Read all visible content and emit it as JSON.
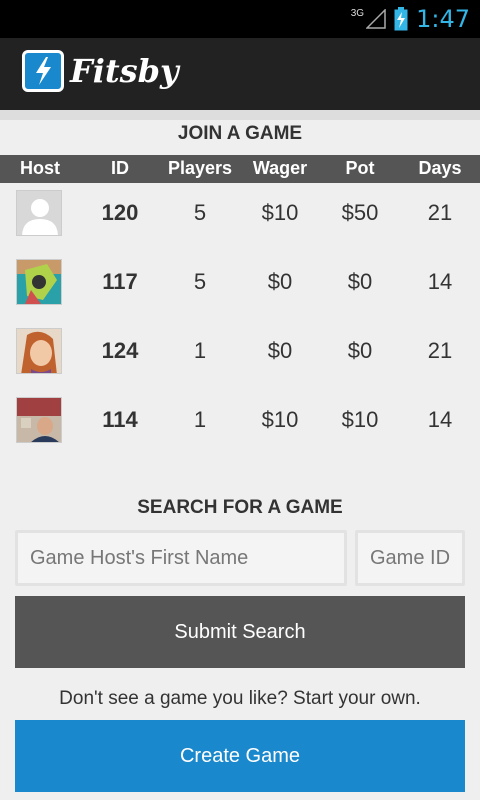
{
  "status_bar": {
    "network": "3G",
    "time": "1:47"
  },
  "app": {
    "title": "Fitsby"
  },
  "join": {
    "title": "JOIN A GAME",
    "columns": [
      "Host",
      "ID",
      "Players",
      "Wager",
      "Pot",
      "Days"
    ],
    "rows": [
      {
        "id": "120",
        "players": "5",
        "wager": "$10",
        "pot": "$50",
        "days": "21"
      },
      {
        "id": "117",
        "players": "5",
        "wager": "$0",
        "pot": "$0",
        "days": "14"
      },
      {
        "id": "124",
        "players": "1",
        "wager": "$0",
        "pot": "$0",
        "days": "21"
      },
      {
        "id": "114",
        "players": "1",
        "wager": "$10",
        "pot": "$10",
        "days": "14"
      }
    ]
  },
  "search": {
    "title": "SEARCH FOR A GAME",
    "host_placeholder": "Game Host's First Name",
    "id_placeholder": "Game ID",
    "submit_label": "Submit Search"
  },
  "create": {
    "prompt": "Don't see a game you like? Start your own.",
    "button_label": "Create Game"
  },
  "colors": {
    "accent": "#1a88cc",
    "header": "#555555",
    "status_text": "#33b5e5"
  }
}
